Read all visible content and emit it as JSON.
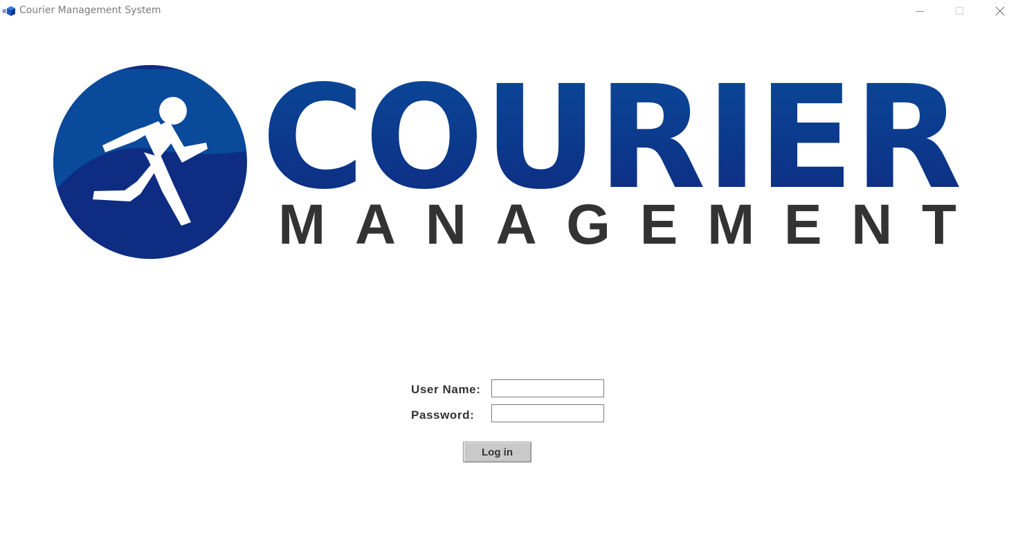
{
  "window": {
    "title": "Courier Management System",
    "icon": "app-cube-icon",
    "controls": {
      "minimize_icon": "minimize-icon",
      "maximize_icon": "maximize-icon",
      "close_icon": "close-icon"
    }
  },
  "logo": {
    "word1": "COURIER",
    "word2": "MANAGEMENT",
    "icon": "running-man-icon",
    "colors": {
      "blue_dark": "#0d2d82",
      "blue_light": "#0a4a9a",
      "text_dark": "#333333"
    }
  },
  "login_form": {
    "username_label": "User Name:",
    "username_value": "",
    "password_label": "Password:",
    "password_value": "",
    "login_button": "Log in"
  }
}
